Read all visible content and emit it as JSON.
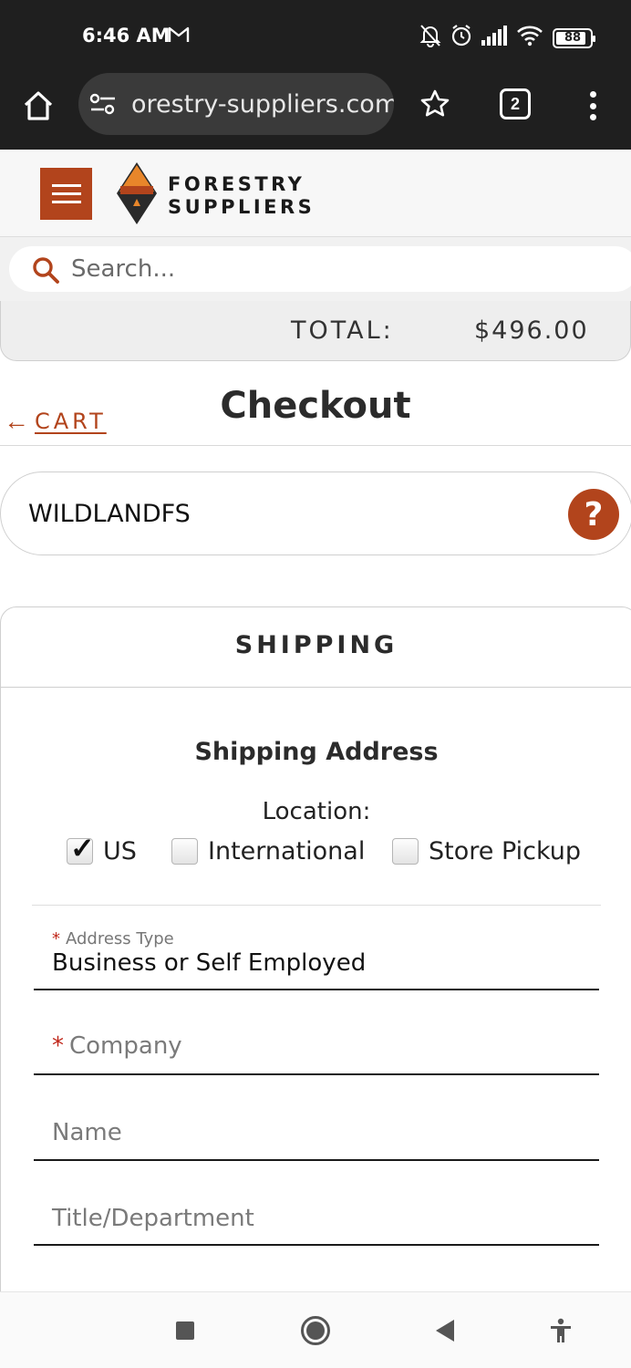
{
  "status_bar": {
    "time": "6:46 AM",
    "battery": "88"
  },
  "browser": {
    "url": "orestry-suppliers.com",
    "tab_count": "2"
  },
  "site": {
    "logo_line1": "FORESTRY",
    "logo_line2": "SUPPLIERS",
    "brand_color": "#b2441c"
  },
  "search": {
    "placeholder": "Search..."
  },
  "total": {
    "label": "TOTAL:",
    "value": "$496.00"
  },
  "checkout": {
    "back_label": "CART",
    "title": "Checkout"
  },
  "promo": {
    "code": "WILDLANDFS",
    "help_label": "?"
  },
  "shipping": {
    "heading": "SHIPPING",
    "subheading": "Shipping Address",
    "location_label": "Location:",
    "location_options": [
      {
        "label": "US",
        "checked": true
      },
      {
        "label": "International",
        "checked": false
      },
      {
        "label": "Store Pickup",
        "checked": false
      }
    ],
    "fields": {
      "address_type_label": "Address Type",
      "address_type_value": "Business or Self Employed",
      "company_placeholder": "Company",
      "name_placeholder": "Name",
      "title_placeholder": "Title/Department"
    }
  }
}
